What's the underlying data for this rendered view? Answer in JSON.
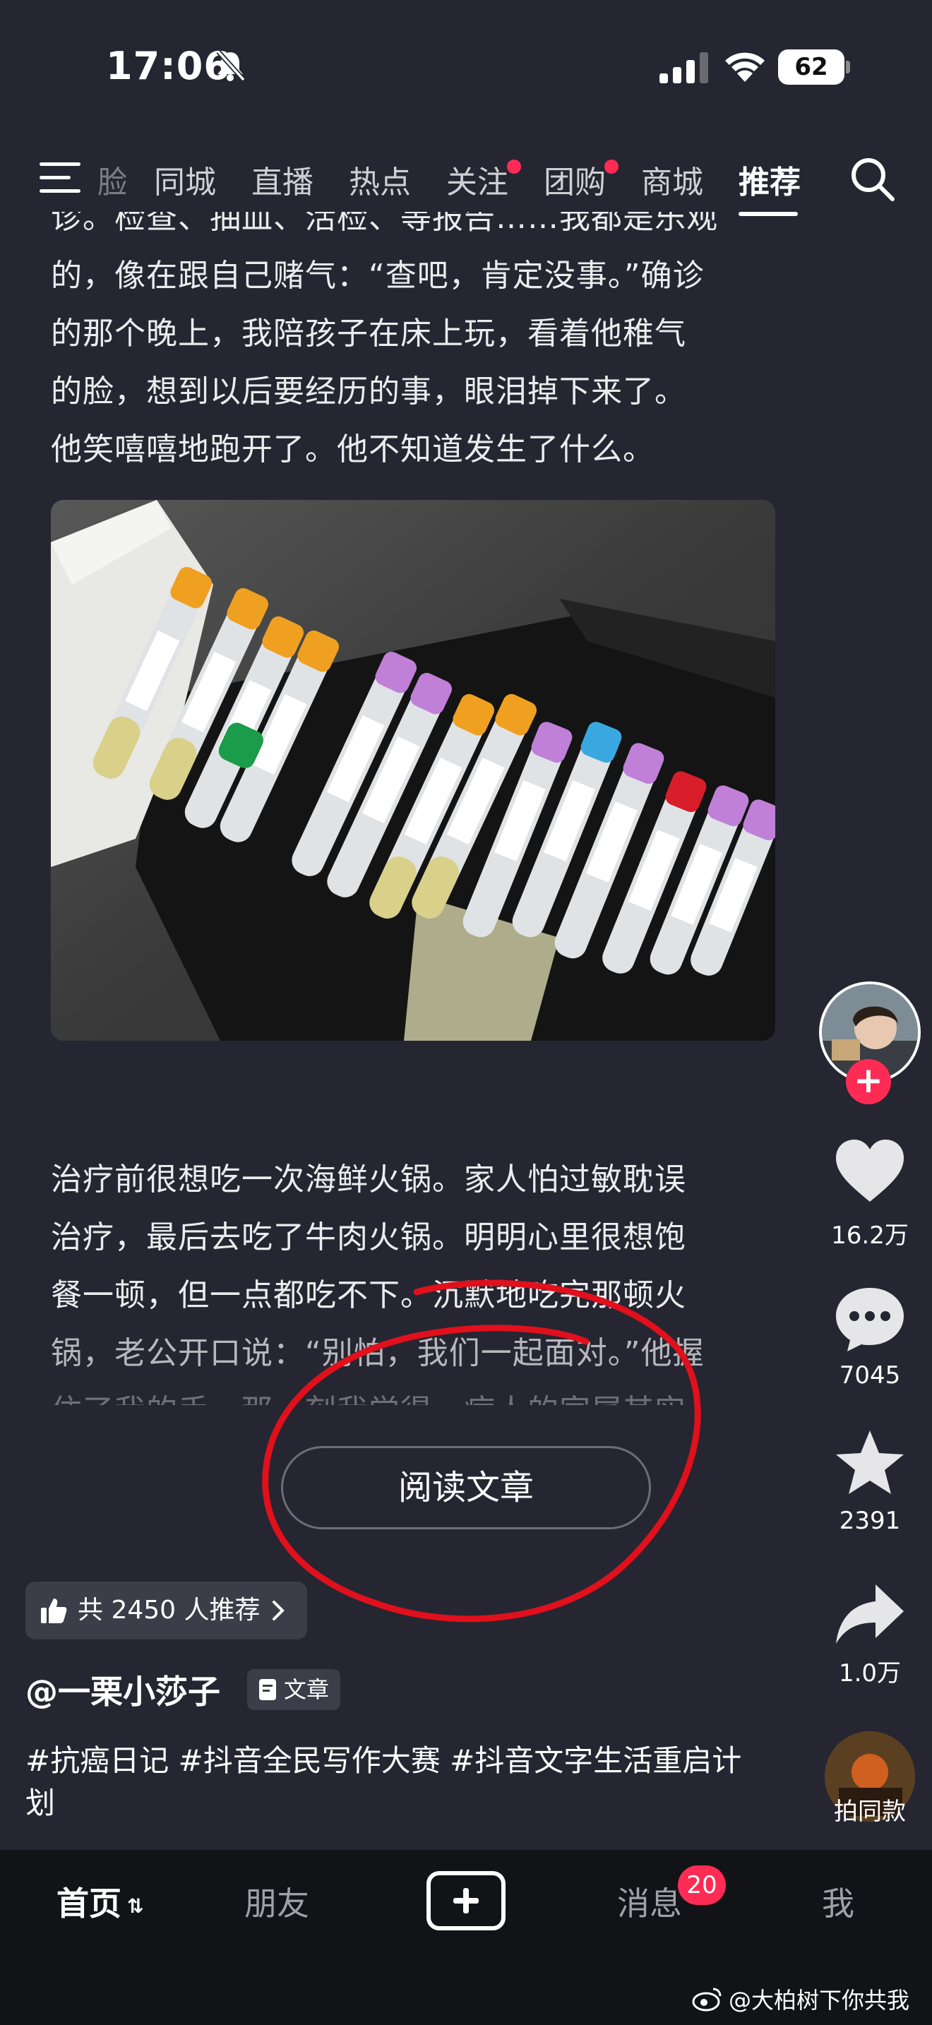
{
  "status_bar": {
    "time": "17:06",
    "battery": "62"
  },
  "top_nav": {
    "tabs": [
      {
        "label": "脸"
      },
      {
        "label": "同城"
      },
      {
        "label": "直播"
      },
      {
        "label": "热点"
      },
      {
        "label": "关注"
      },
      {
        "label": "团购"
      },
      {
        "label": "商城"
      },
      {
        "label": "推荐"
      }
    ]
  },
  "article": {
    "lines_top": [
      "诊。检查、抽血、活检、等报告……我都是乐观",
      "的，像在跟自己赌气：“查吧，肯定没事。”确诊",
      "的那个晚上，我陪孩子在床上玩，看着他稚气",
      "的脸，想到以后要经历的事，眼泪掉下来了。",
      "他笑嘻嘻地跑开了。他不知道发生了什么。"
    ],
    "lines_bottom": [
      "治疗前很想吃一次海鲜火锅。家人怕过敏耽误",
      "治疗，最后去吃了牛肉火锅。明明心里很想饱",
      "餐一顿，但一点都吃不下。沉默地吃完那顿火",
      "锅，老公开口说：“别怕，我们一起面对。”他握",
      "住了我的手，那一刻我觉得，病人的家属其实"
    ],
    "read_button": "阅读文章"
  },
  "recommend": {
    "label": "共 2450 人推荐"
  },
  "author": {
    "name": "@一栗小莎子",
    "badge": "文章"
  },
  "tags": "#抗癌日记 #抖音全民写作大赛 #抖音文字生活重启计划",
  "rail": {
    "likes": "16.2万",
    "comments": "7045",
    "favorites": "2391",
    "shares": "1.0万",
    "same_style": "拍同款"
  },
  "tab_bar": {
    "home": "首页",
    "friends": "朋友",
    "messages": "消息",
    "messages_badge": "20",
    "me": "我"
  },
  "watermark": "@大柏树下你共我",
  "colors": {
    "background": "#252631",
    "accent_red": "#fe2c55",
    "annotation_red": "#e0101c"
  },
  "icons": [
    "bell-off-icon",
    "signal-icon",
    "wifi-icon",
    "menu-icon",
    "search-icon",
    "heart-icon",
    "comment-icon",
    "star-icon",
    "share-icon",
    "thumbs-up-icon",
    "chevron-right-icon",
    "document-icon",
    "plus-icon",
    "weibo-icon"
  ]
}
